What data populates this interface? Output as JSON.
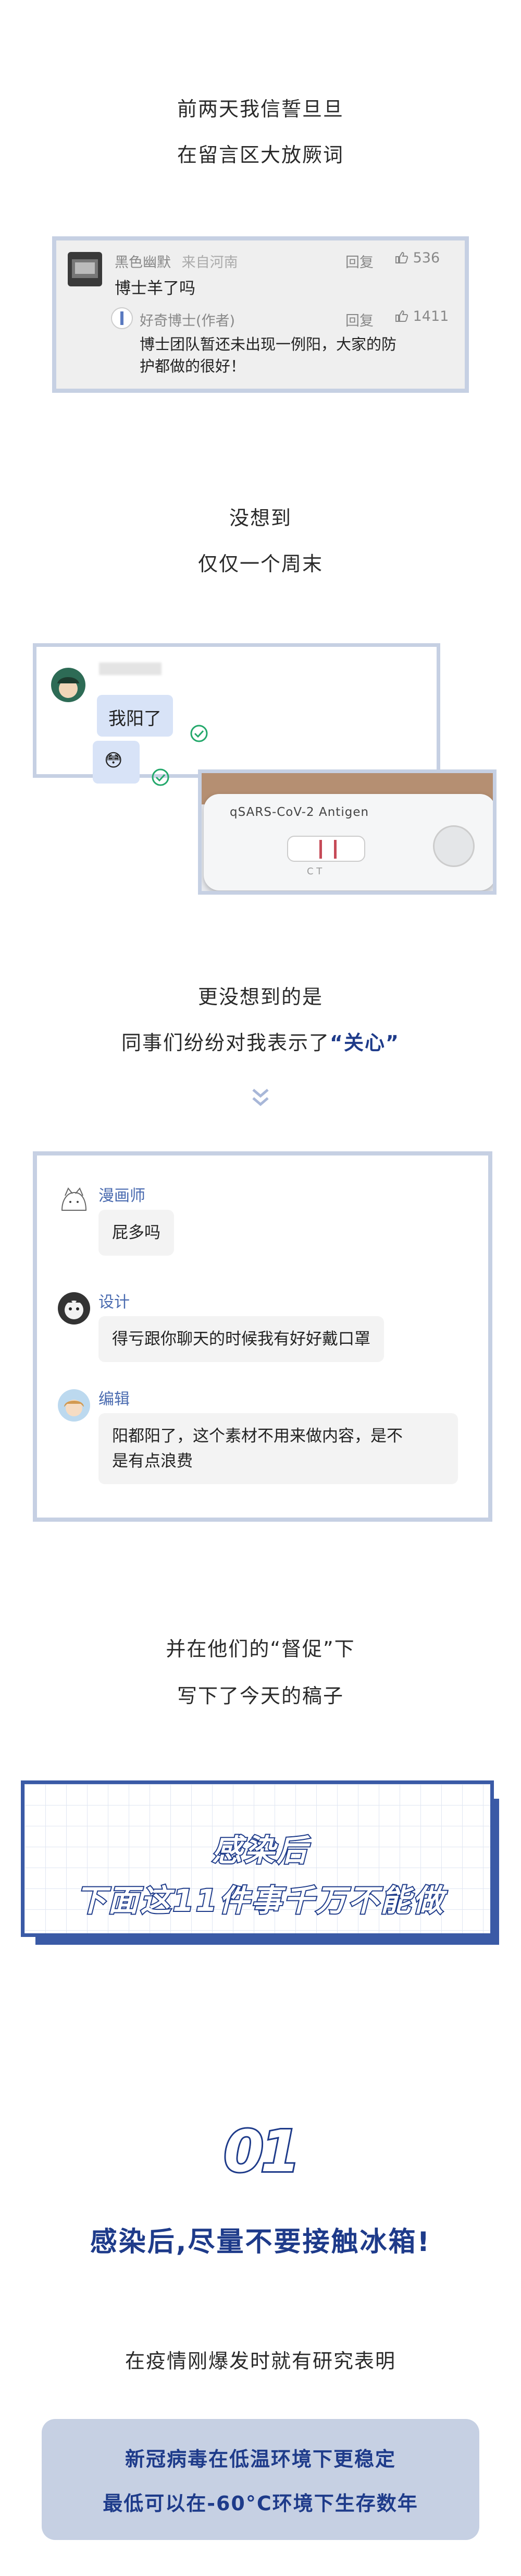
{
  "intro": {
    "line1": "前两天我信誓旦旦",
    "line2": "在留言区大放厥词"
  },
  "comment": {
    "user": "黑色幽默",
    "location": "来自河南",
    "reply_label": "回复",
    "likes": "536",
    "text": "博士羊了吗",
    "reply": {
      "user": "好奇博士(作者)",
      "reply_label": "回复",
      "likes": "1411",
      "text_line1": "博士团队暂还未出现一例阳，大家的防",
      "text_line2": "护都做的很好！"
    }
  },
  "mid1": {
    "line1": "没想到",
    "line2": "仅仅一个周末"
  },
  "chat": {
    "message1": "我阳了",
    "message2": "😳",
    "test_label": "qSARS-CoV-2 Antigen",
    "test_marks": "C   T"
  },
  "mid2": {
    "line1": "更没想到的是",
    "line2_prefix": "同事们纷纷对我表示了",
    "line2_highlight": "“关心”"
  },
  "group_chat": {
    "m1_name": "漫画师",
    "m1_text": "屁多吗",
    "m2_name": "设计",
    "m2_text": "得亏跟你聊天的时候我有好好戴口罩",
    "m3_name": "编辑",
    "m3_text_line1": "阳都阳了，这个素材不用来做内容，是不",
    "m3_text_line2": "是有点浪费"
  },
  "mid3": {
    "line1": "并在他们的“督促”下",
    "line2": "写下了今天的稿子"
  },
  "banner": {
    "line1": "感染后",
    "line2": "下面这11件事千万不能做"
  },
  "section1": {
    "number": "01",
    "title": "感染后,尽量不要接触冰箱!",
    "lead": "在疫情刚爆发时就有研究表明",
    "note_line1": "新冠病毒在低温环境下更稳定",
    "note_line2": "最低可以在-60°C环境下生存数年"
  },
  "colors": {
    "accent": "#1e3b8a",
    "frame": "#c6d0e3",
    "banner_fill": "#3a5aa6"
  }
}
